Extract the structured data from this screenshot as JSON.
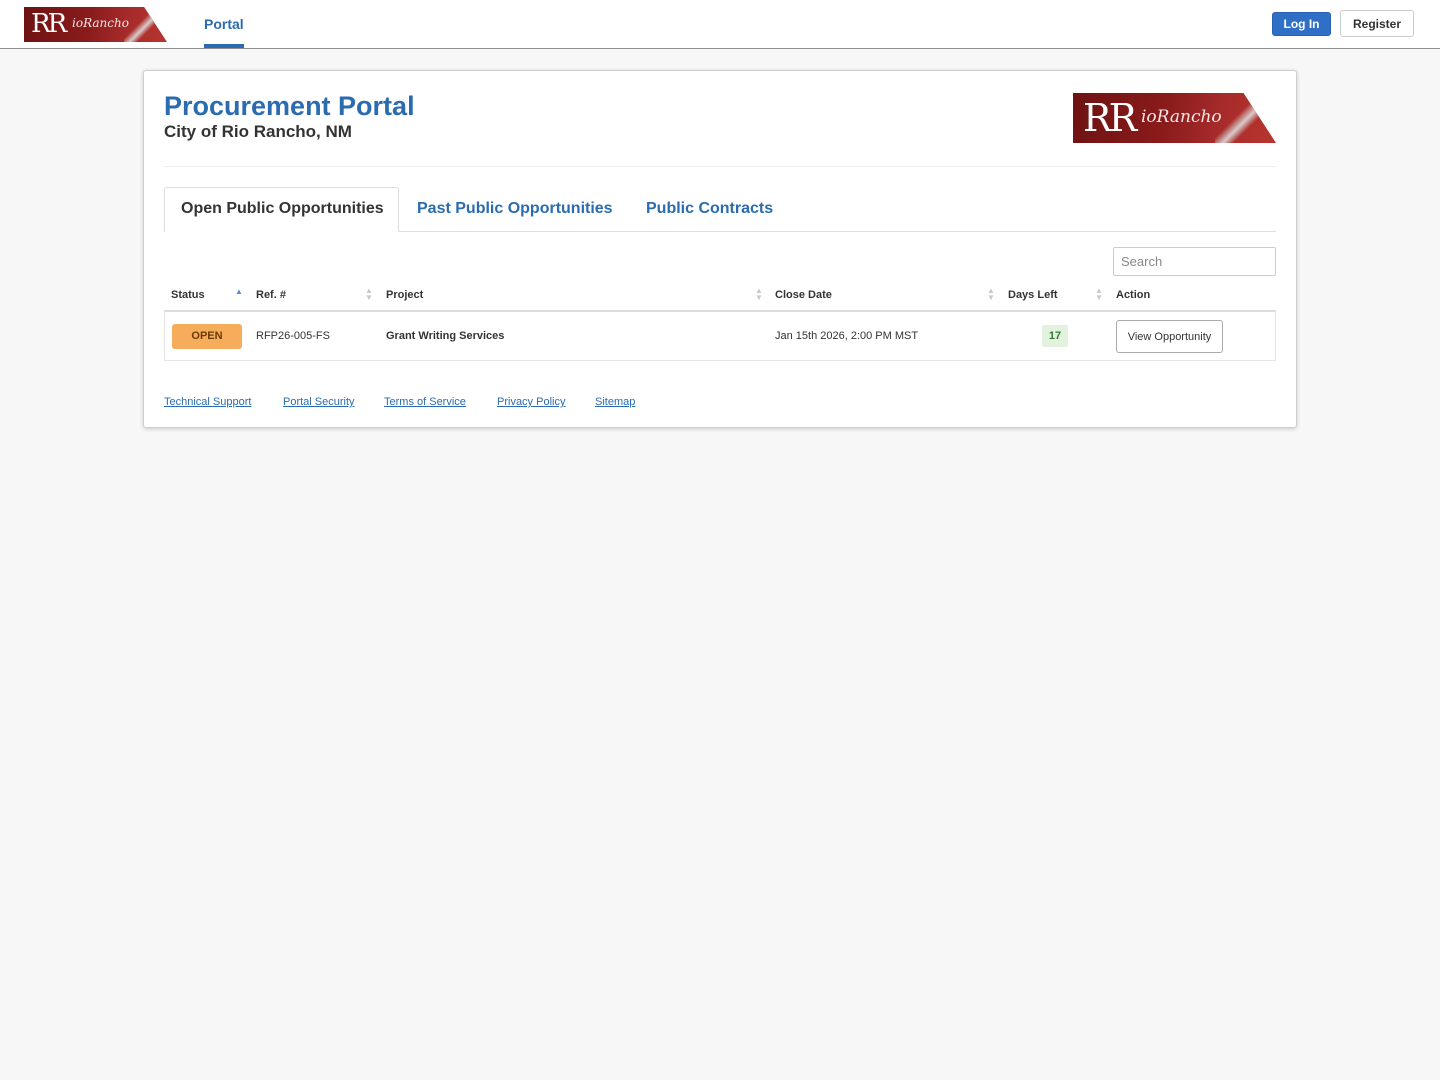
{
  "header": {
    "logo": {
      "monogram": "RR",
      "wordmark": "ioRancho"
    },
    "nav": {
      "portal_label": "Portal"
    },
    "login_label": "Log In",
    "register_label": "Register"
  },
  "page": {
    "title": "Procurement Portal",
    "subtitle": "City of Rio Rancho, NM"
  },
  "tabs": [
    {
      "label": "Open Public Opportunities",
      "active": true
    },
    {
      "label": "Past Public Opportunities",
      "active": false
    },
    {
      "label": "Public Contracts",
      "active": false
    }
  ],
  "search": {
    "placeholder": "Search"
  },
  "table": {
    "columns": [
      "Status",
      "Ref. #",
      "Project",
      "Close Date",
      "Days Left",
      "Action"
    ],
    "sorted_column": "Status",
    "sort_direction": "ascending",
    "rows": [
      {
        "status": "OPEN",
        "ref": "RFP26-005-FS",
        "project": "Grant Writing Services",
        "close_date": "Jan 15th 2026, 2:00 PM MST",
        "days_left": "17",
        "action": "View Opportunity"
      }
    ]
  },
  "footer": {
    "links": [
      "Technical Support",
      "Portal Security",
      "Terms of Service",
      "Privacy Policy",
      "Sitemap"
    ]
  },
  "colors": {
    "brand_blue": "#2b6cb0",
    "login_blue": "#2f6fc6",
    "open_badge": "#f6ad5b",
    "days_left_bg": "#e3f1df",
    "logo_red": "#8a1b1b"
  }
}
